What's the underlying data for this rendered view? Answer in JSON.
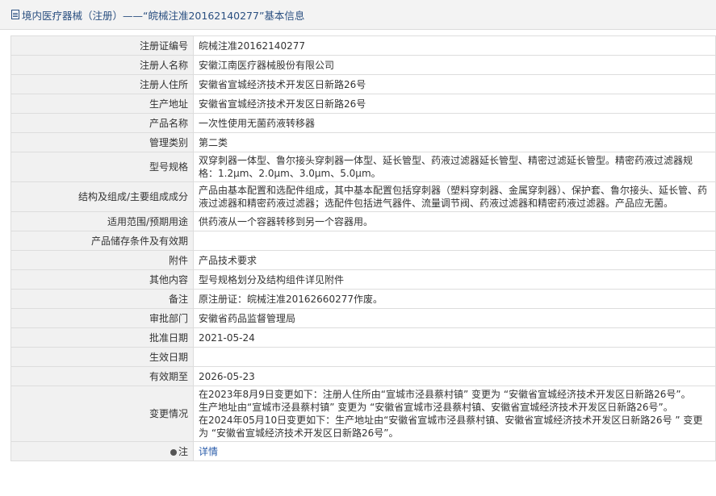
{
  "header": {
    "title": "境内医疗器械（注册）——“皖械注准20162140277”基本信息"
  },
  "rows": [
    {
      "label": "注册证编号",
      "value": "皖械注准20162140277"
    },
    {
      "label": "注册人名称",
      "value": "安徽江南医疗器械股份有限公司"
    },
    {
      "label": "注册人住所",
      "value": "安徽省宣城经济技术开发区日新路26号"
    },
    {
      "label": "生产地址",
      "value": "安徽省宣城经济技术开发区日新路26号"
    },
    {
      "label": "产品名称",
      "value": "一次性使用无菌药液转移器"
    },
    {
      "label": "管理类别",
      "value": "第二类"
    },
    {
      "label": "型号规格",
      "value": "双穿刺器一体型、鲁尔接头穿刺器一体型、延长管型、药液过滤器延长管型、精密过滤延长管型。精密药液过滤器规格：1.2μm、2.0μm、3.0μm、5.0μm。"
    },
    {
      "label": "结构及组成/主要组成成分",
      "value": "产品由基本配置和选配件组成，其中基本配置包括穿刺器（塑料穿刺器、金属穿刺器）、保护套、鲁尔接头、延长管、药液过滤器和精密药液过滤器；选配件包括进气器件、流量调节阀、药液过滤器和精密药液过滤器。产品应无菌。"
    },
    {
      "label": "适用范围/预期用途",
      "value": "供药液从一个容器转移到另一个容器用。"
    },
    {
      "label": "产品储存条件及有效期",
      "value": ""
    },
    {
      "label": "附件",
      "value": "产品技术要求"
    },
    {
      "label": "其他内容",
      "value": "型号规格划分及结构组件详见附件"
    },
    {
      "label": "备注",
      "value": "原注册证：皖械注准20162660277作废。"
    },
    {
      "label": "审批部门",
      "value": "安徽省药品监督管理局"
    },
    {
      "label": "批准日期",
      "value": "2021-05-24"
    },
    {
      "label": "生效日期",
      "value": ""
    },
    {
      "label": "有效期至",
      "value": "2026-05-23"
    }
  ],
  "changes": {
    "label": "变更情况",
    "lines": [
      "在2023年8月9日变更如下：注册人住所由“宣城市泾县蔡村镇” 变更为 “安徽省宣城经济技术开发区日新路26号”。",
      "生产地址由“宣城市泾县蔡村镇” 变更为 “安徽省宣城市泾县蔡村镇、安徽省宣城经济技术开发区日新路26号”。",
      "在2024年05月10日变更如下：生产地址由“安徽省宣城市泾县蔡村镇、安徽省宣城经济技术开发区日新路26号 ” 变更为 “安徽省宣城经济技术开发区日新路26号”。"
    ]
  },
  "note": {
    "label": "注",
    "link": "详情",
    "icon": "bullet-icon"
  }
}
